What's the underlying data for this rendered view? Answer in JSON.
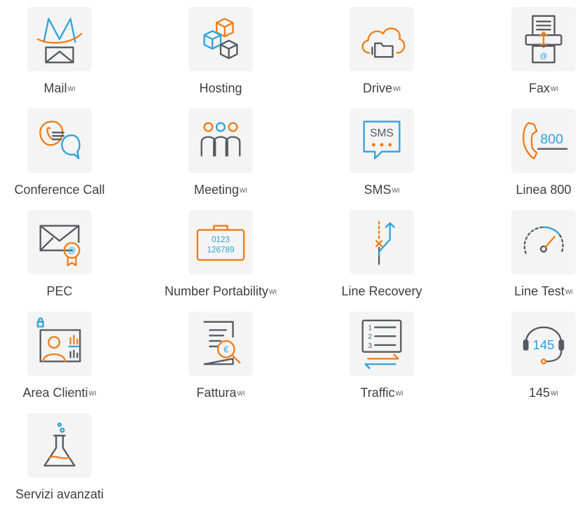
{
  "colors": {
    "accent_orange": "#f07d18",
    "accent_blue": "#2fa3dc",
    "icon_gray": "#555b61",
    "tile_bg": "#f4f4f4"
  },
  "services": [
    {
      "label": "Mail",
      "sup": "WI",
      "icon": "mail-icon"
    },
    {
      "label": "Hosting",
      "sup": "",
      "icon": "hosting-cubes-icon"
    },
    {
      "label": "Drive",
      "sup": "WI",
      "icon": "cloud-folder-icon"
    },
    {
      "label": "Fax",
      "sup": "WI",
      "icon": "fax-icon"
    },
    {
      "label": "Conference Call",
      "sup": "",
      "icon": "conference-call-icon"
    },
    {
      "label": "Meeting",
      "sup": "WI",
      "icon": "meeting-people-icon"
    },
    {
      "label": "SMS",
      "sup": "WI",
      "icon": "sms-bubble-icon"
    },
    {
      "label": "Linea 800",
      "sup": "",
      "icon": "phone-800-icon"
    },
    {
      "label": "PEC",
      "sup": "",
      "icon": "certified-mail-icon"
    },
    {
      "label": "Number Portability",
      "sup": "WI",
      "icon": "number-briefcase-icon"
    },
    {
      "label": "Line Recovery",
      "sup": "",
      "icon": "line-recovery-icon"
    },
    {
      "label": "Line Test",
      "sup": "WI",
      "icon": "speed-gauge-icon"
    },
    {
      "label": "Area Clienti",
      "sup": "WI",
      "icon": "client-area-icon"
    },
    {
      "label": "Fattura",
      "sup": "WI",
      "icon": "invoice-icon"
    },
    {
      "label": "Traffic",
      "sup": "WI",
      "icon": "traffic-list-icon"
    },
    {
      "label": "145",
      "sup": "WI",
      "icon": "headset-145-icon"
    },
    {
      "label": "Servizi avanzati",
      "sup": "",
      "icon": "lab-flask-icon"
    }
  ],
  "icon_text": {
    "fax_at": "@",
    "sms": "SMS",
    "linea": "800",
    "pec_at": "@",
    "port_top": "0123",
    "port_bottom": "126789",
    "invoice_euro": "€",
    "traffic_1": "1",
    "traffic_2": "2",
    "traffic_3": "3",
    "headset": "145"
  }
}
